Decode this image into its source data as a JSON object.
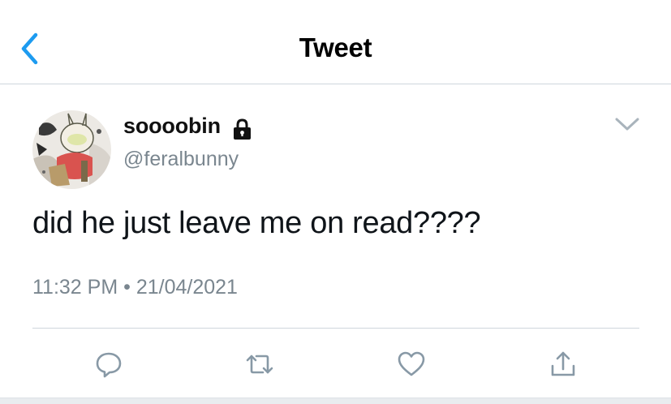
{
  "header": {
    "title": "Tweet",
    "back_icon": "chevron-left-icon"
  },
  "tweet": {
    "display_name": "soooobin",
    "handle": "@feralbunny",
    "protected_icon": "lock-icon",
    "text": "did he just leave me on read????",
    "time": "11:32 PM",
    "separator": "•",
    "date": "21/04/2021"
  },
  "actions": {
    "icons": [
      "reply-icon",
      "retweet-icon",
      "like-icon",
      "share-icon"
    ]
  },
  "colors": {
    "accent": "#1d9bf0",
    "secondary_text": "#7a868f",
    "icon": "#8899a6",
    "divider": "#cfd6dc"
  }
}
